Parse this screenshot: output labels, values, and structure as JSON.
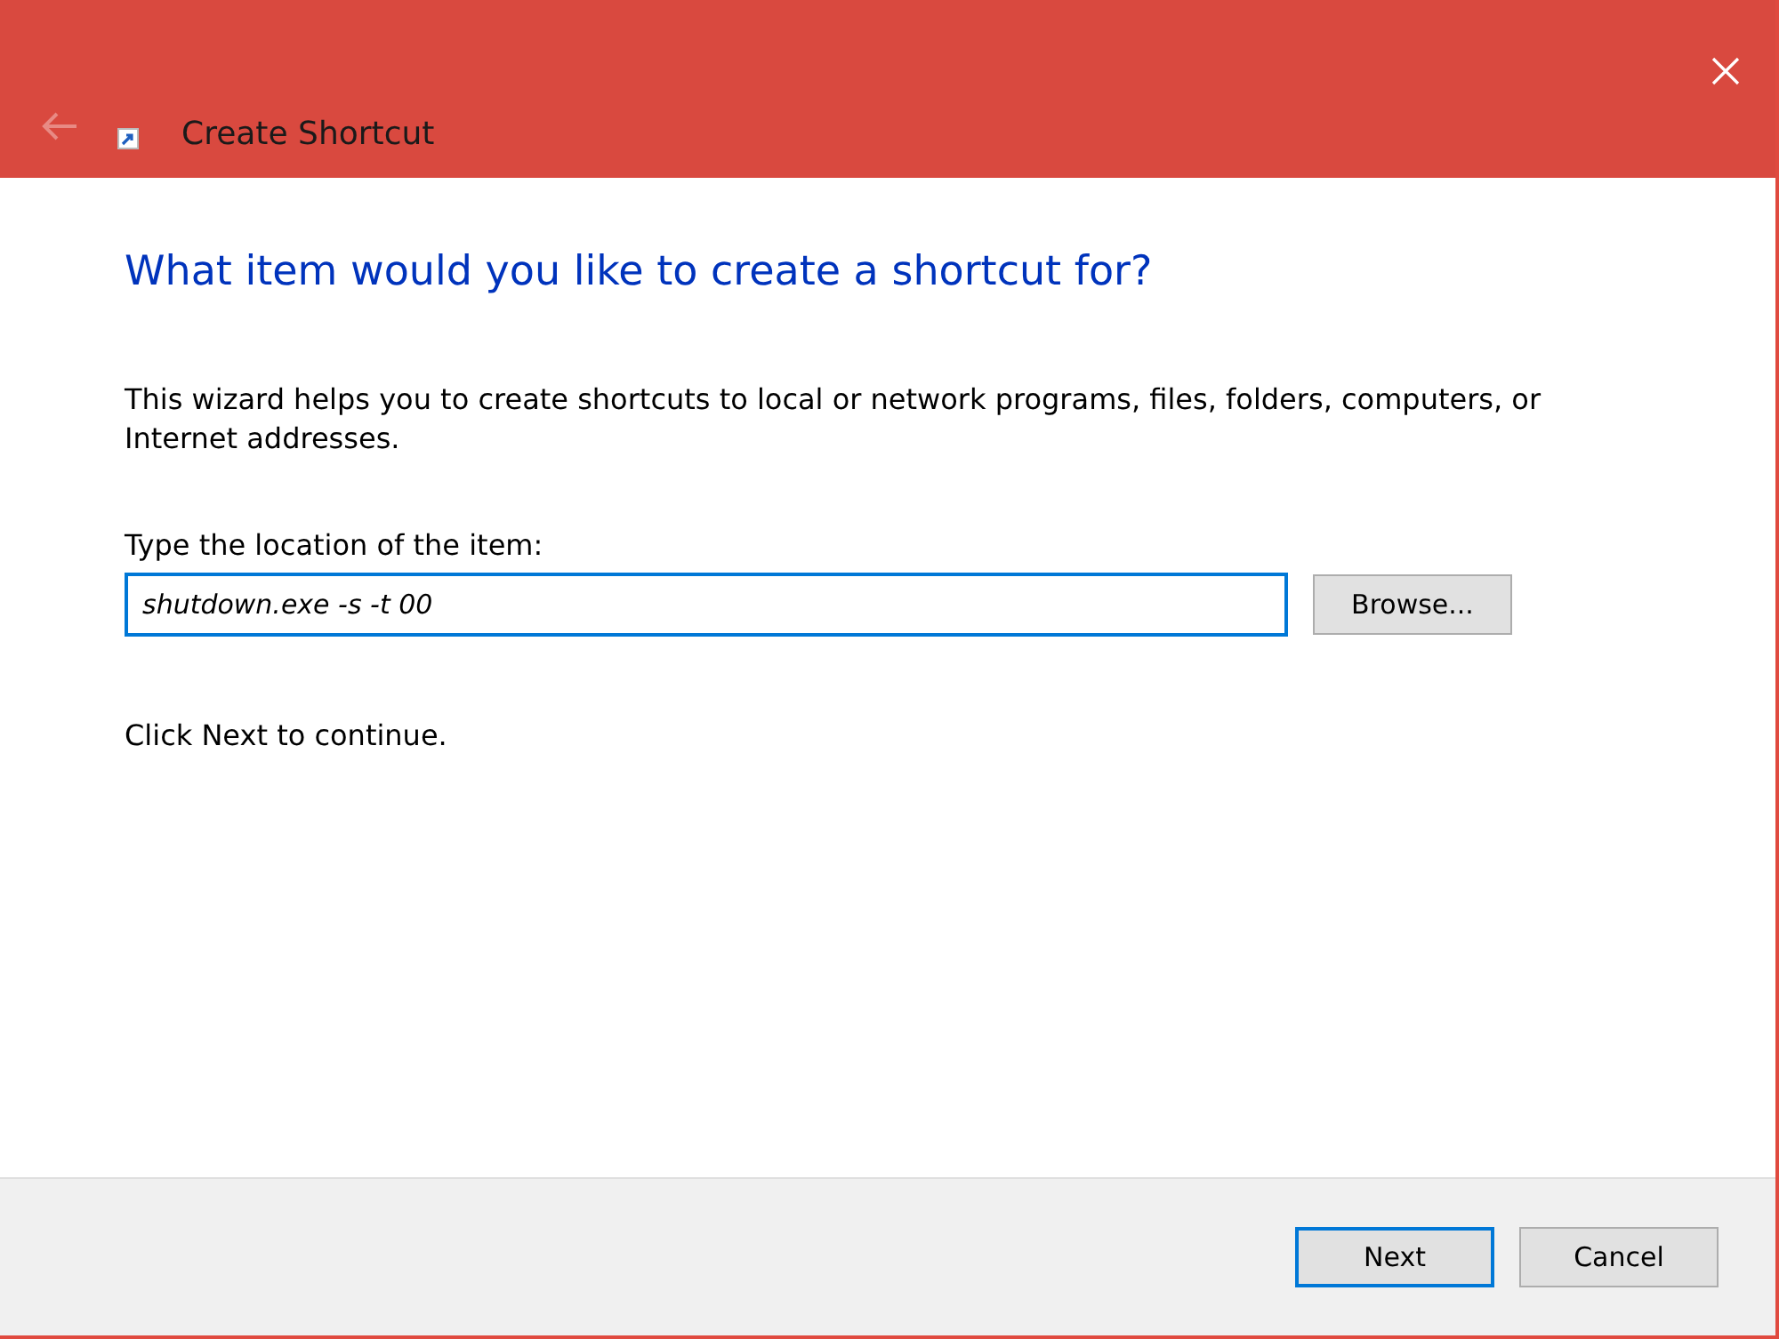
{
  "window": {
    "title": "Create Shortcut"
  },
  "heading": "What item would you like to create a shortcut for?",
  "description": "This wizard helps you to create shortcuts to local or network programs, files, folders, computers, or Internet addresses.",
  "location": {
    "label": "Type the location of the item:",
    "value": "shutdown.exe -s -t 00",
    "focused": true,
    "browse_button": "Browse..."
  },
  "hint": "Click Next to continue.",
  "buttons": [
    {
      "label": "Next",
      "default": true
    },
    {
      "label": "Cancel",
      "default": false
    }
  ]
}
